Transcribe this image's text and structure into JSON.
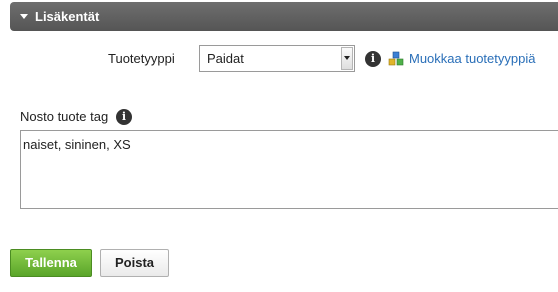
{
  "section": {
    "title": "Lisäkentät",
    "expanded": true
  },
  "product_type": {
    "label": "Tuotetyyppi",
    "selected": "Paidat",
    "edit_link": "Muokkaa tuotetyyppiä"
  },
  "nosto_tag": {
    "label": "Nosto tuote tag",
    "value": "naiset, sininen, XS"
  },
  "actions": {
    "save": "Tallenna",
    "delete": "Poista"
  },
  "icons": {
    "info": "info-icon",
    "product_types": "cubes-icon",
    "collapse": "caret-down-icon"
  },
  "colors": {
    "header_bg": "#5f5f5f",
    "link": "#2a6fb8",
    "save_button": "#6db83a"
  }
}
